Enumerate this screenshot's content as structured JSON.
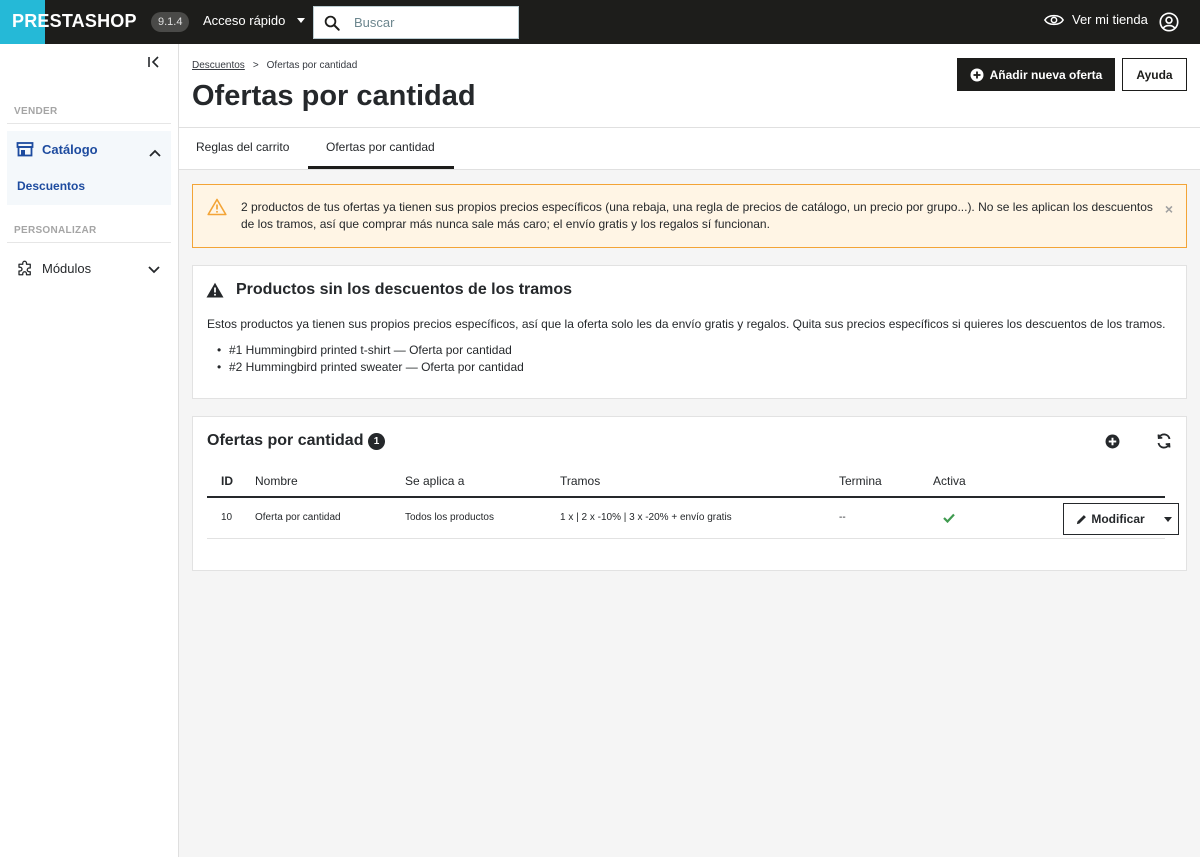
{
  "topbar": {
    "logo": "PRESTASHOP",
    "version": "9.1.4",
    "quick_access": "Acceso rápido",
    "search_placeholder": "Buscar",
    "view_store": "Ver mi tienda"
  },
  "sidebar": {
    "section_sell": "VENDER",
    "catalog": "Catálogo",
    "catalog_sub": "Descuentos",
    "section_customize": "PERSONALIZAR",
    "modules": "Módulos"
  },
  "header": {
    "breadcrumb_parent": "Descuentos",
    "breadcrumb_separator": ">",
    "breadcrumb_current": "Ofertas por cantidad",
    "title": "Ofertas por cantidad",
    "add_button": "Añadir nueva oferta",
    "help_button": "Ayuda"
  },
  "tabs": [
    {
      "label": "Reglas del carrito"
    },
    {
      "label": "Ofertas por cantidad"
    }
  ],
  "alert": {
    "text": "2 productos de tus ofertas ya tienen sus propios precios específicos (una rebaja, una regla de precios de catálogo, un precio por grupo...). No se les aplican los descuentos de los tramos, así que comprar más nunca sale más caro; el envío gratis y los regalos sí funcionan.",
    "close": "×"
  },
  "warning_card": {
    "title": "Productos sin los descuentos de los tramos",
    "description": "Estos productos ya tienen sus propios precios específicos, así que la oferta solo les da envío gratis y regalos. Quita sus precios específicos si quieres los descuentos de los tramos.",
    "items": [
      "#1 Hummingbird printed t-shirt — Oferta por cantidad",
      "#2 Hummingbird printed sweater — Oferta por cantidad"
    ]
  },
  "offers_card": {
    "title": "Ofertas por cantidad",
    "count": "1",
    "columns": {
      "id": "ID",
      "name": "Nombre",
      "applies_to": "Se aplica a",
      "tiers": "Tramos",
      "ends": "Termina",
      "active": "Activa"
    },
    "rows": [
      {
        "id": "10",
        "name": "Oferta por cantidad",
        "applies_to": "Todos los productos",
        "tiers": "1 x | 2 x -10% | 3 x -20% + envío gratis",
        "ends": "--",
        "active": true
      }
    ],
    "edit_button": "Modificar"
  },
  "colors": {
    "topbar_bg": "#1d1d1b",
    "logo_blue": "#25b9d7",
    "nav_active": "#1d4b9f",
    "alert_border": "#f3a436",
    "alert_bg": "#fff5e5",
    "check_green": "#3f9a4f"
  }
}
